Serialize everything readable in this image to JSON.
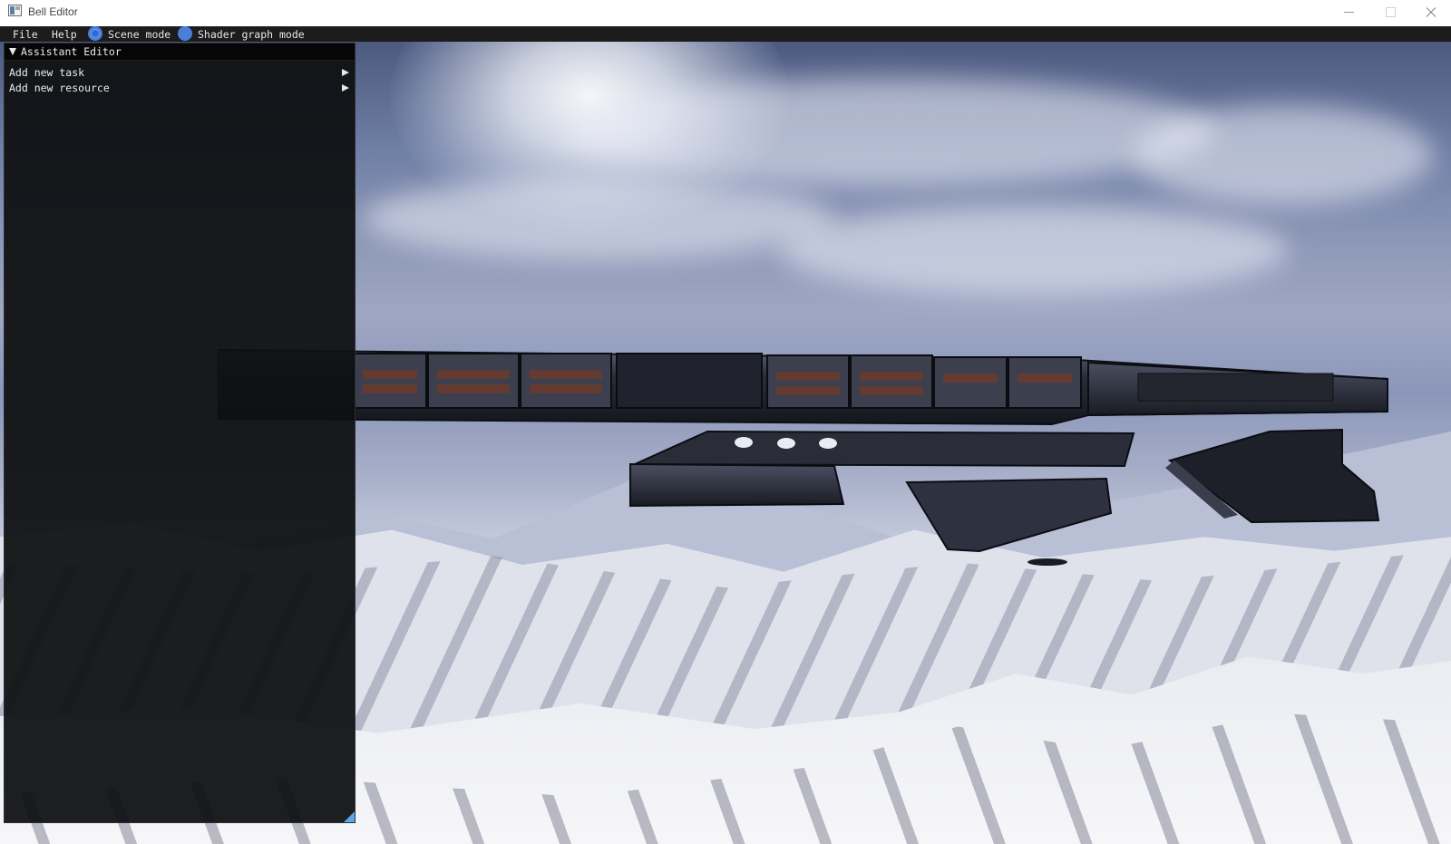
{
  "window": {
    "title": "Bell Editor",
    "controls": [
      "minimize",
      "maximize",
      "close"
    ]
  },
  "menubar": {
    "items": [
      {
        "label": "File"
      },
      {
        "label": "Help"
      }
    ],
    "modes": [
      {
        "label": "Scene mode",
        "selected": true
      },
      {
        "label": "Shader graph mode",
        "selected": false
      }
    ]
  },
  "panel": {
    "title": "Assistant Editor",
    "items": [
      {
        "label": "Add new task"
      },
      {
        "label": "Add new resource"
      }
    ]
  },
  "icons": {
    "app": "app-window-icon",
    "collapse": "triangle-down-icon",
    "submenu": "triangle-right-icon",
    "resize": "resize-grip-icon"
  },
  "colors": {
    "accent": "#4a7ed8",
    "panel_bg": "#0f1012",
    "menubar_bg": "#1c1c1c",
    "resize_grip": "#5aa6e8"
  }
}
